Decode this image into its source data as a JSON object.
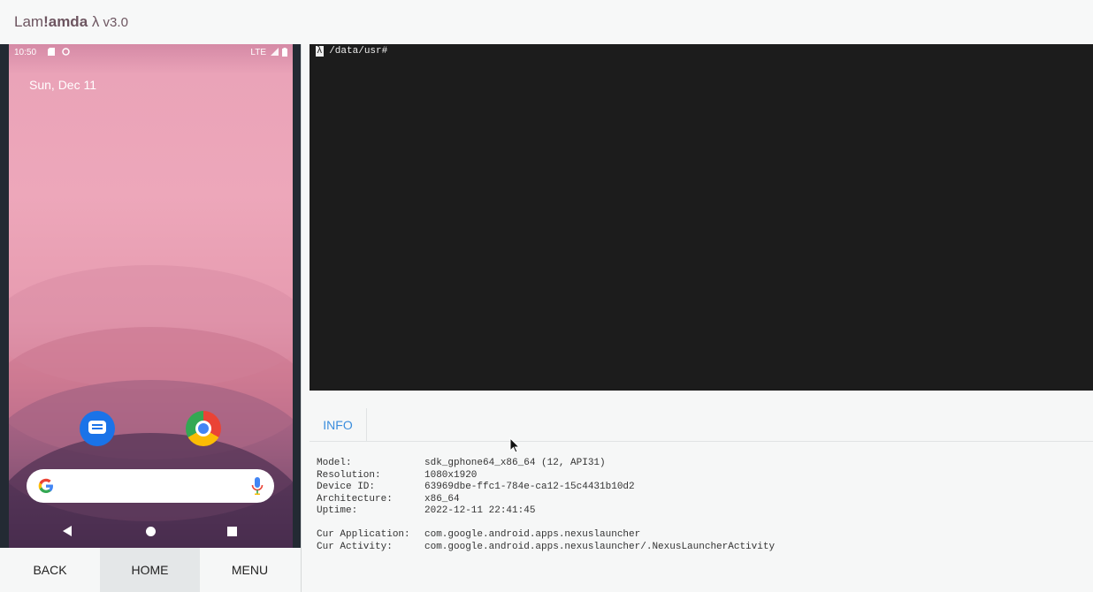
{
  "titlebar": {
    "name_prefix": "Lam",
    "name_bold": "!amda",
    "name_suffix": " λ",
    "version": " v3.0"
  },
  "device": {
    "statusbar": {
      "time": "10:50",
      "network": "LTE"
    },
    "date": "Sun, Dec 11",
    "apps": [
      {
        "name": "messages-app-icon"
      },
      {
        "name": "chrome-app-icon"
      }
    ]
  },
  "hw_buttons": {
    "back": "BACK",
    "home": "HOME",
    "menu": "MENU",
    "active": "HOME"
  },
  "terminal": {
    "prompt_symbol": "λ",
    "prompt_path": " /data/usr#"
  },
  "tabs": {
    "info": "INFO"
  },
  "info": {
    "model_label": "Model:",
    "model": "sdk_gphone64_x86_64 (12, API31)",
    "resolution_label": "Resolution:",
    "resolution": "1080x1920",
    "device_id_label": "Device ID:",
    "device_id": "63969dbe-ffc1-784e-ca12-15c4431b10d2",
    "arch_label": "Architecture:",
    "arch": "x86_64",
    "uptime_label": "Uptime:",
    "uptime": "2022-12-11 22:41:45",
    "app_label": "Cur Application:",
    "app": "com.google.android.apps.nexuslauncher",
    "activity_label": "Cur Activity:",
    "activity": "com.google.android.apps.nexuslauncher/.NexusLauncherActivity"
  },
  "colors": {
    "accent": "#3b8ddd",
    "terminal_bg": "#1c1c1c",
    "title": "#6d5560"
  }
}
